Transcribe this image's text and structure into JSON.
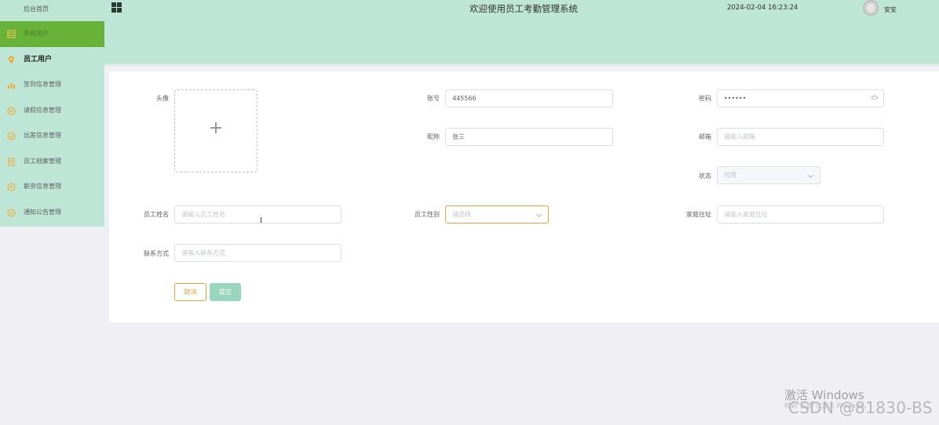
{
  "sidebar": {
    "home": "后台首页",
    "items": [
      {
        "label": "系统用户",
        "icon": "table-icon",
        "active": true
      },
      {
        "label": "员工用户",
        "icon": "location-pin-icon"
      },
      {
        "label": "签到信息管理",
        "icon": "bar-chart-icon"
      },
      {
        "label": "请假信息管理",
        "icon": "chat-icon"
      },
      {
        "label": "出差信息管理",
        "icon": "check-circle-icon"
      },
      {
        "label": "员工档案管理",
        "icon": "document-icon"
      },
      {
        "label": "薪资信息管理",
        "icon": "chat-icon"
      },
      {
        "label": "通知公告管理",
        "icon": "check-circle-icon"
      }
    ]
  },
  "header": {
    "title": "欢迎使用员工考勤管理系统",
    "datetime": "2024-02-04 16:23:24",
    "username": "安安"
  },
  "form": {
    "avatar_label": "头像",
    "avatar_plus": "+",
    "account_label": "账号",
    "account_value": "445566",
    "password_label": "密码",
    "password_value": "••••••",
    "nickname_label": "昵称",
    "nickname_value": "张三",
    "email_label": "邮箱",
    "email_placeholder": "请输入邮箱",
    "status_label": "状态",
    "status_value": "可用",
    "name_label": "员工姓名",
    "name_placeholder": "请输入员工姓名",
    "gender_label": "员工性别",
    "gender_placeholder": "请选择",
    "address_label": "家庭住址",
    "address_placeholder": "请输入家庭住址",
    "contact_label": "联系方式",
    "contact_placeholder": "请输入联系方式",
    "cancel_label": "取消",
    "submit_label": "提交"
  },
  "watermark": {
    "activate": "激活 Windows",
    "activate_sub": "转到\"设置\"以激活 Windows。",
    "csdn": "CSDN @81830-BS"
  },
  "colors": {
    "sidebar_bg": "#bde6d6",
    "active_item": "#67b33a",
    "accent_orange": "#e6a23c",
    "submit_bg": "#99d6c0"
  }
}
